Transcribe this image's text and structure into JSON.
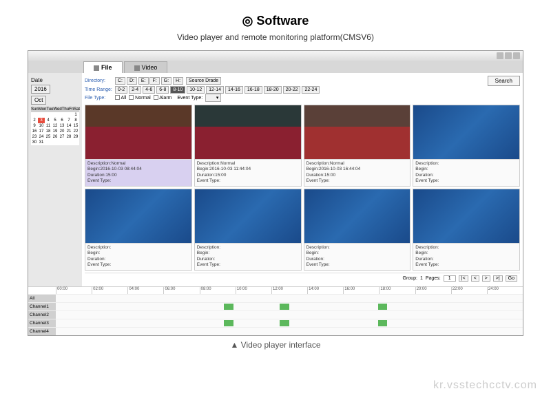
{
  "header": {
    "title_prefix": "◎ ",
    "title": "Software",
    "subtitle": "Video player and remote monitoring platform(CMSV6)"
  },
  "tabs": [
    {
      "icon": "file-icon",
      "label": "File",
      "active": true
    },
    {
      "icon": "video-icon",
      "label": "Video",
      "active": false
    }
  ],
  "sidebar": {
    "date_label": "Date",
    "year": "2016",
    "month": "Oct",
    "weekdays": [
      "Sun",
      "Mon",
      "Tue",
      "Wed",
      "Thu",
      "Fri",
      "Sat"
    ],
    "days": [
      "",
      "",
      "",
      "",
      "",
      "",
      "1",
      "2",
      "3",
      "4",
      "5",
      "6",
      "7",
      "8",
      "9",
      "10",
      "11",
      "12",
      "13",
      "14",
      "15",
      "16",
      "17",
      "18",
      "19",
      "20",
      "21",
      "22",
      "23",
      "24",
      "25",
      "26",
      "27",
      "28",
      "29",
      "30",
      "31",
      "",
      "",
      "",
      "",
      ""
    ],
    "selected_day": "3"
  },
  "filters": {
    "directory_label": "Directory:",
    "drives": [
      "C:",
      "D:",
      "E:",
      "F:",
      "G:",
      "H:"
    ],
    "scan_local": "Source Drade",
    "time_range_label": "Time Range:",
    "ranges": [
      "0-2",
      "2-4",
      "4-6",
      "6-8",
      "8-10",
      "10-12",
      "12-14",
      "14-16",
      "16-18",
      "18-20",
      "20-22",
      "22-24"
    ],
    "selected_range": "8-10",
    "file_type_label": "File Type:",
    "file_types": [
      "All",
      "Normal",
      "Alarm"
    ],
    "event_type_label": "Event Type:",
    "search": "Search"
  },
  "cards": [
    {
      "thumb": "bus1",
      "hl": true,
      "desc": "Description:Normal",
      "begin": "Begin:2016-10-03 08:44:04",
      "dur": "Duration:15:00",
      "evt": "Event Type:"
    },
    {
      "thumb": "bus2",
      "desc": "Description:Normal",
      "begin": "Begin:2016-10-03 11:44:04",
      "dur": "Duration:15:00",
      "evt": "Event Type:"
    },
    {
      "thumb": "bus3",
      "desc": "Description:Normal",
      "begin": "Begin:2016-10-03 16:44:04",
      "dur": "Duration:15:00",
      "evt": "Event Type:"
    },
    {
      "thumb": "blue",
      "desc": "Description:",
      "begin": "Begin:",
      "dur": "Duration:",
      "evt": "Event Type:"
    },
    {
      "thumb": "blue",
      "desc": "Description:",
      "begin": "Begin:",
      "dur": "Duration:",
      "evt": "Event Type:"
    },
    {
      "thumb": "blue",
      "desc": "Description:",
      "begin": "Begin:",
      "dur": "Duration:",
      "evt": "Event Type:"
    },
    {
      "thumb": "blue",
      "desc": "Description:",
      "begin": "Begin:",
      "dur": "Duration:",
      "evt": "Event Type:"
    },
    {
      "thumb": "blue",
      "desc": "Description:",
      "begin": "Begin:",
      "dur": "Duration:",
      "evt": "Event Type:"
    }
  ],
  "pager": {
    "group_label": "Group:",
    "group": "1",
    "pages_label": "Pages:",
    "page": "1",
    "go": "Go",
    "first": "|<",
    "prev": "<",
    "next": ">",
    "last": ">|"
  },
  "timeline": {
    "hours": [
      "00:00",
      "02:00",
      "04:00",
      "06:00",
      "08:00",
      "10:00",
      "12:00",
      "14:00",
      "16:00",
      "18:00",
      "20:00",
      "22:00",
      "24:00"
    ],
    "rows": [
      {
        "label": "All",
        "segments": []
      },
      {
        "label": "Channel1",
        "segments": [
          {
            "start": 36,
            "width": 2
          },
          {
            "start": 48,
            "width": 2
          },
          {
            "start": 69,
            "width": 2
          }
        ]
      },
      {
        "label": "Channel2",
        "segments": []
      },
      {
        "label": "Channel3",
        "segments": [
          {
            "start": 36,
            "width": 2
          },
          {
            "start": 48,
            "width": 2
          },
          {
            "start": 69,
            "width": 2
          }
        ]
      },
      {
        "label": "Channel4",
        "segments": []
      }
    ]
  },
  "caption": "▲ Video player interface",
  "watermark": "kr.vsstechcctv.com"
}
